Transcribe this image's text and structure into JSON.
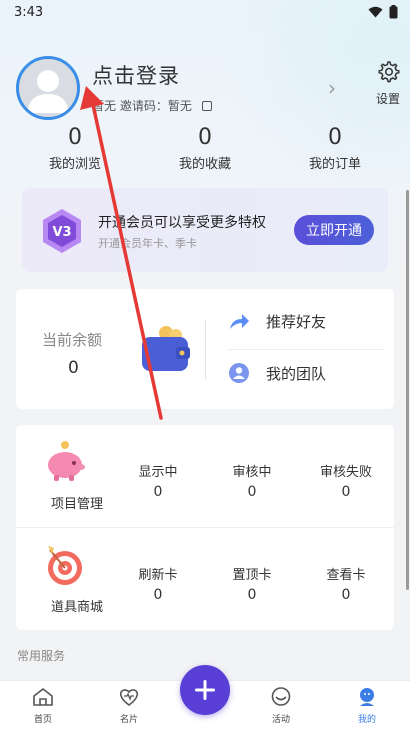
{
  "status_bar": {
    "time": "3:43"
  },
  "profile": {
    "login_label": "点击登录",
    "invite_text": "暂无  邀请码：暂无",
    "settings_label": "设置"
  },
  "stats": [
    {
      "value": "0",
      "label": "我的浏览"
    },
    {
      "value": "0",
      "label": "我的收藏"
    },
    {
      "value": "0",
      "label": "我的订单"
    }
  ],
  "vip": {
    "title": "开通会员可以享受更多特权",
    "subtitle": "开通会员年卡、季卡",
    "button_label": "立即开通"
  },
  "balance": {
    "label": "当前余额",
    "value": "0",
    "recommend_label": "推荐好友",
    "team_label": "我的团队"
  },
  "project_management": {
    "label": "项目管理",
    "cells": [
      {
        "label": "显示中",
        "value": "0"
      },
      {
        "label": "审核中",
        "value": "0"
      },
      {
        "label": "审核失败",
        "value": "0"
      }
    ]
  },
  "props_store": {
    "label": "道具商城",
    "cells": [
      {
        "label": "刷新卡",
        "value": "0"
      },
      {
        "label": "置顶卡",
        "value": "0"
      },
      {
        "label": "查看卡",
        "value": "0"
      }
    ]
  },
  "section_title": "常用服务",
  "tabs": [
    {
      "label": "首页",
      "icon": "home-icon"
    },
    {
      "label": "名片",
      "icon": "card-icon"
    },
    {
      "label": "活动",
      "icon": "chat-icon"
    },
    {
      "label": "我的",
      "icon": "profile-icon",
      "active": true
    }
  ],
  "colors": {
    "accent": "#5a3fd6",
    "vip_button": "#5b4fd9",
    "active_tab": "#3b7de6",
    "annotation_arrow": "#e53935"
  }
}
